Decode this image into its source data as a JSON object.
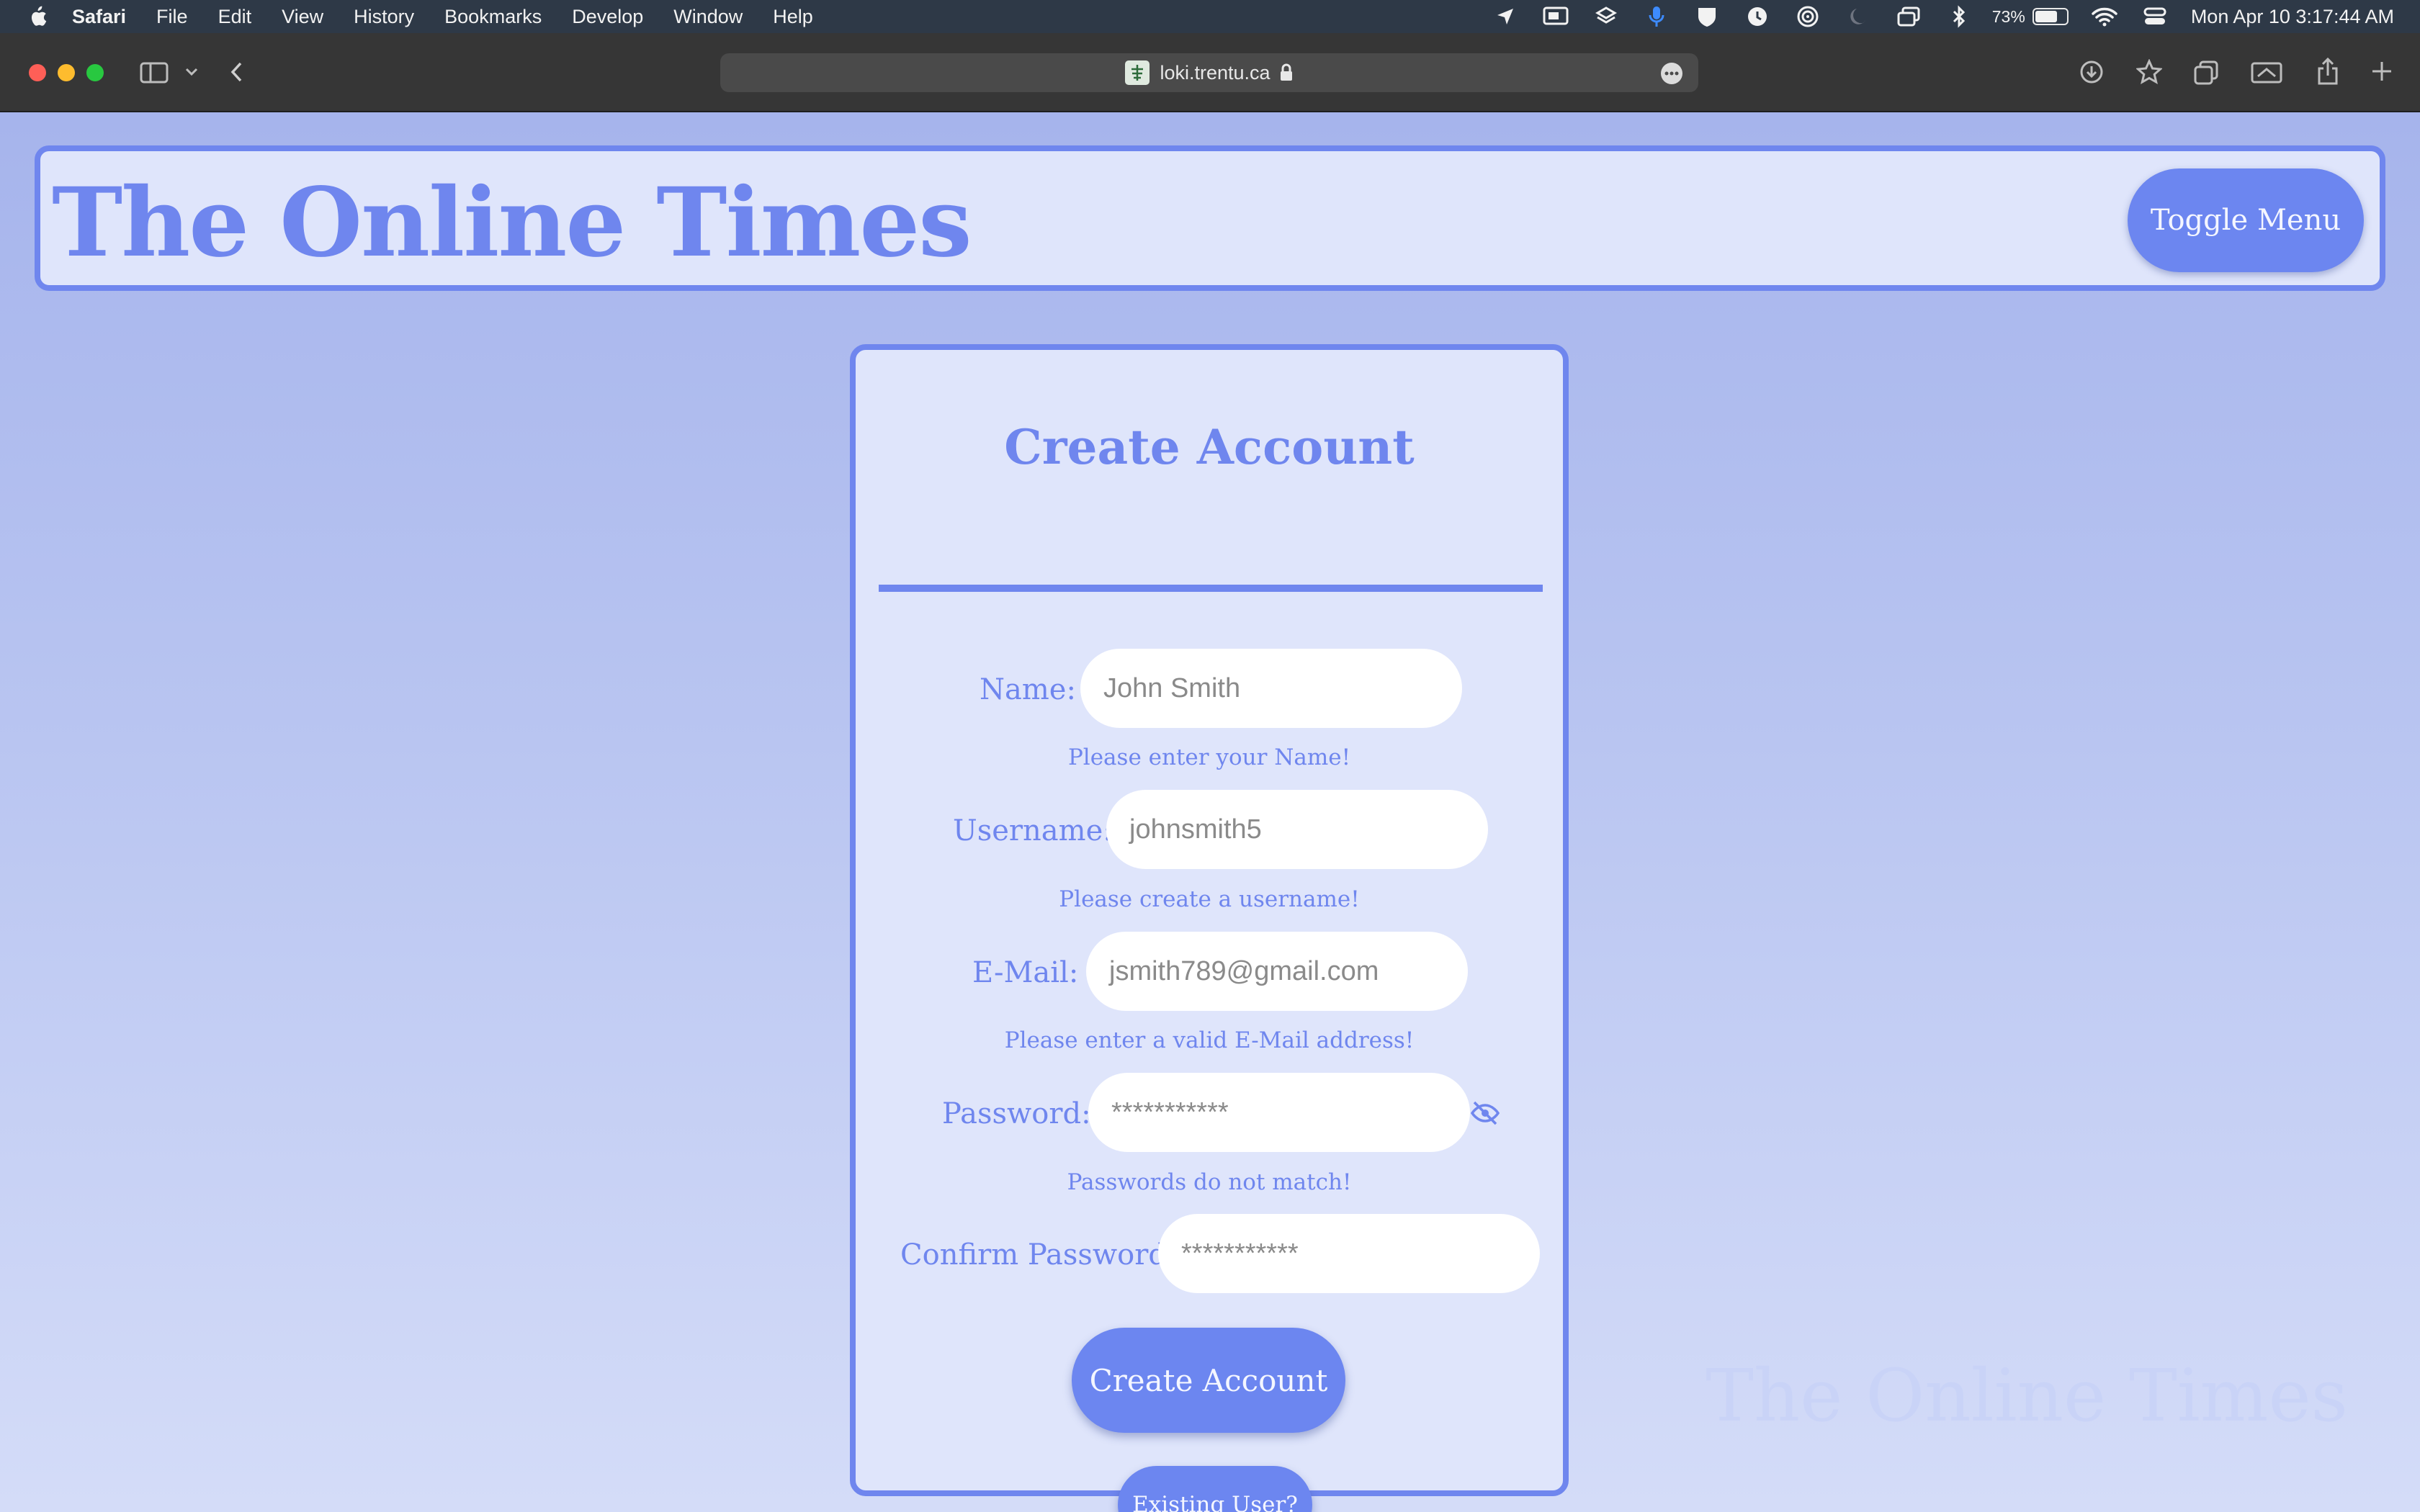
{
  "menubar": {
    "app_name": "Safari",
    "items": [
      "File",
      "Edit",
      "View",
      "History",
      "Bookmarks",
      "Develop",
      "Window",
      "Help"
    ],
    "battery_percent": "73%",
    "battery_level": 0.73,
    "clock": "Mon Apr 10  3:17:44 AM"
  },
  "browser": {
    "url": "loki.trentu.ca"
  },
  "site": {
    "title": "The Online Times",
    "toggle_menu_label": "Toggle Menu",
    "watermark": "The Online Times"
  },
  "form": {
    "title": "Create Account",
    "fields": [
      {
        "label": "Name:",
        "placeholder": "John Smith",
        "hint": "Please enter your Name!"
      },
      {
        "label": "Username:",
        "placeholder": "johnsmith5",
        "hint": "Please create a username!"
      },
      {
        "label": "E-Mail:",
        "placeholder": "jsmith789@gmail.com",
        "hint": "Please enter a valid E-Mail address!"
      },
      {
        "label": "Password:",
        "placeholder": "***********",
        "hint": "Passwords do not match!"
      },
      {
        "label": "Confirm Password:",
        "placeholder": "***********"
      }
    ],
    "submit_label": "Create Account",
    "existing_user_label": "Existing User?"
  },
  "colors": {
    "accent": "#6f86ee",
    "card_bg": "#dfe5fb",
    "button_bg": "#6c86f0"
  }
}
